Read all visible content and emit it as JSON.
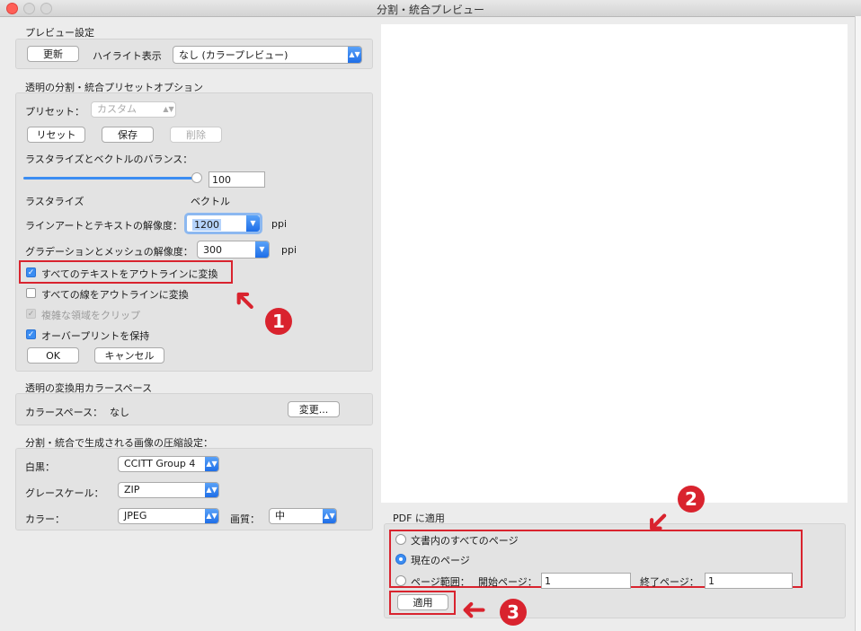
{
  "window": {
    "title": "分割・統合プレビュー"
  },
  "preview_settings": {
    "group_label": "プレビュー設定",
    "refresh_label": "更新",
    "highlight_label": "ハイライト表示",
    "highlight_value": "なし (カラープレビュー)"
  },
  "preset_options": {
    "group_label": "透明の分割・統合プリセットオプション",
    "preset_label": "プリセット：",
    "preset_value": "カスタム",
    "reset_label": "リセット",
    "save_label": "保存",
    "delete_label": "削除",
    "balance_label": "ラスタライズとベクトルのバランス：",
    "balance_value": "100",
    "balance_fraction": 1.0,
    "raster_label": "ラスタライズ",
    "vector_label": "ベクトル",
    "lineart_label": "ラインアートとテキストの解像度：",
    "lineart_value": "1200",
    "lineart_unit": "ppi",
    "gradient_label": "グラデーションとメッシュの解像度：",
    "gradient_value": "300",
    "gradient_unit": "ppi",
    "cb_text_outline": "すべてのテキストをアウトラインに変換",
    "cb_stroke_outline": "すべての線をアウトラインに変換",
    "cb_clip": "複雑な領域をクリップ",
    "cb_overprint": "オーバープリントを保持",
    "ok_label": "OK",
    "cancel_label": "キャンセル"
  },
  "colorspace": {
    "group_label": "透明の変換用カラースペース",
    "label": "カラースペース：",
    "value": "なし",
    "change_label": "変更..."
  },
  "compression": {
    "group_label": "分割・統合で生成される画像の圧縮設定：",
    "mono_label": "白黒：",
    "mono_value": "CCITT Group 4",
    "gray_label": "グレースケール：",
    "gray_value": "ZIP",
    "color_label": "カラー：",
    "color_value": "JPEG",
    "quality_label": "画質：",
    "quality_value": "中"
  },
  "apply_pdf": {
    "group_label": "PDF に適用",
    "radio_all": "文書内のすべてのページ",
    "radio_current": "現在のページ",
    "radio_range": "ページ範囲：",
    "start_label": "開始ページ：",
    "start_value": "1",
    "end_label": "終了ページ：",
    "end_value": "1",
    "apply_label": "適用"
  },
  "callouts": {
    "one": "1",
    "two": "2",
    "three": "3"
  },
  "colors": {
    "accent": "#3b8df2",
    "callout": "#d9232e"
  }
}
